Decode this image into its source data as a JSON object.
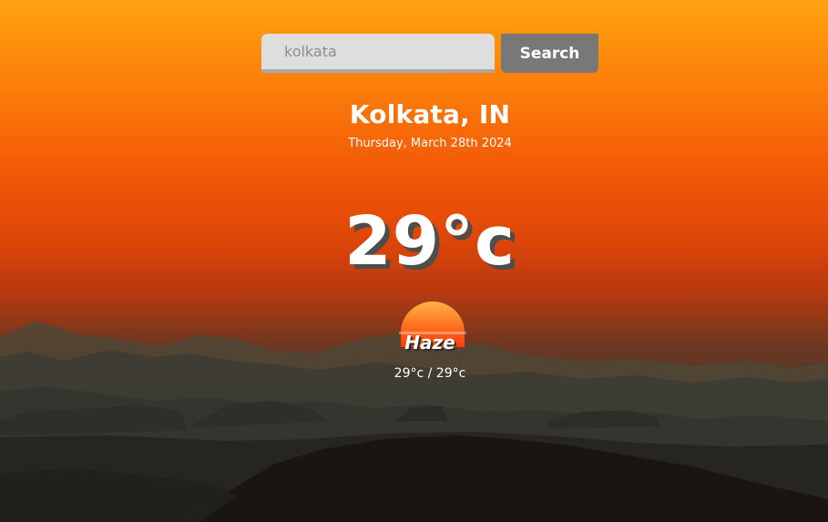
{
  "search": {
    "value": "kolkata",
    "placeholder": "",
    "button_label": "Search"
  },
  "location": {
    "city": "Kolkata, IN",
    "date": "Thursday, March 28th 2024"
  },
  "weather": {
    "temperature": "29°c",
    "condition": "Haze",
    "condition_icon": "haze-sun-icon",
    "hi_lo": "29°c / 29°c"
  },
  "theme": {
    "sky_top": "#ffa30f",
    "sky_mid": "#f35a06",
    "ground": "#1d1b18",
    "button_bg": "#787878",
    "input_bg": "#dedede"
  }
}
